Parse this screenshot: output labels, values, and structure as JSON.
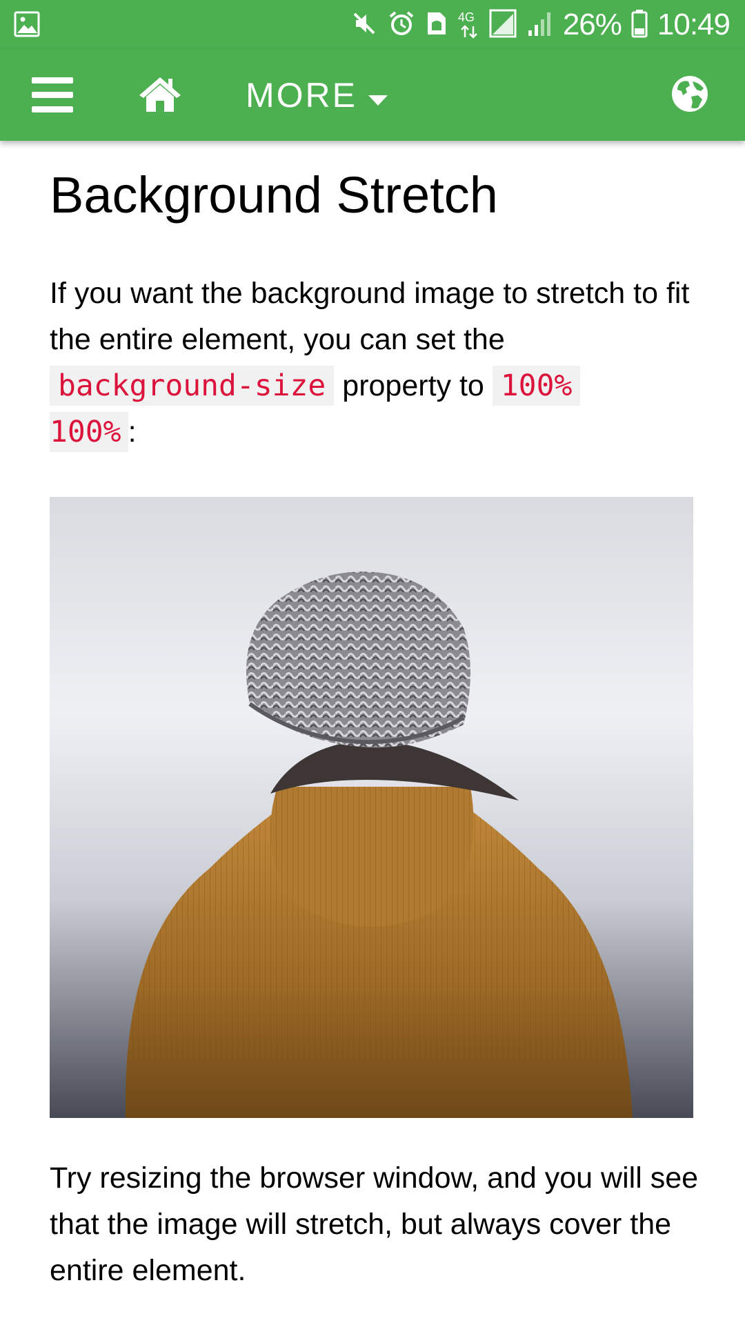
{
  "status_bar": {
    "battery": "26%",
    "time": "10:49",
    "network": "4G",
    "icons": [
      "gallery-icon",
      "mute-icon",
      "alarm-icon",
      "sim-icon",
      "network-4g-icon",
      "signal-icon",
      "signal-icon",
      "battery-icon"
    ]
  },
  "toolbar": {
    "more_label": "MORE",
    "icons": [
      "menu-icon",
      "home-icon",
      "caret-down-icon",
      "globe-icon"
    ]
  },
  "page": {
    "title": "Background Stretch",
    "intro_text_1": "If you want the background image to stretch to fit the entire element, you can set the",
    "code_property": "background-size",
    "intro_text_2": "property to",
    "code_value_1": "100%",
    "code_value_2": "100%",
    "intro_text_3": ":",
    "outro_text": "Try resizing the browser window, and you will see that the image will stretch, but always cover the entire element."
  },
  "colors": {
    "accent": "#4caf50",
    "code_text": "#dc143c",
    "code_background": "#f1f1f1"
  }
}
